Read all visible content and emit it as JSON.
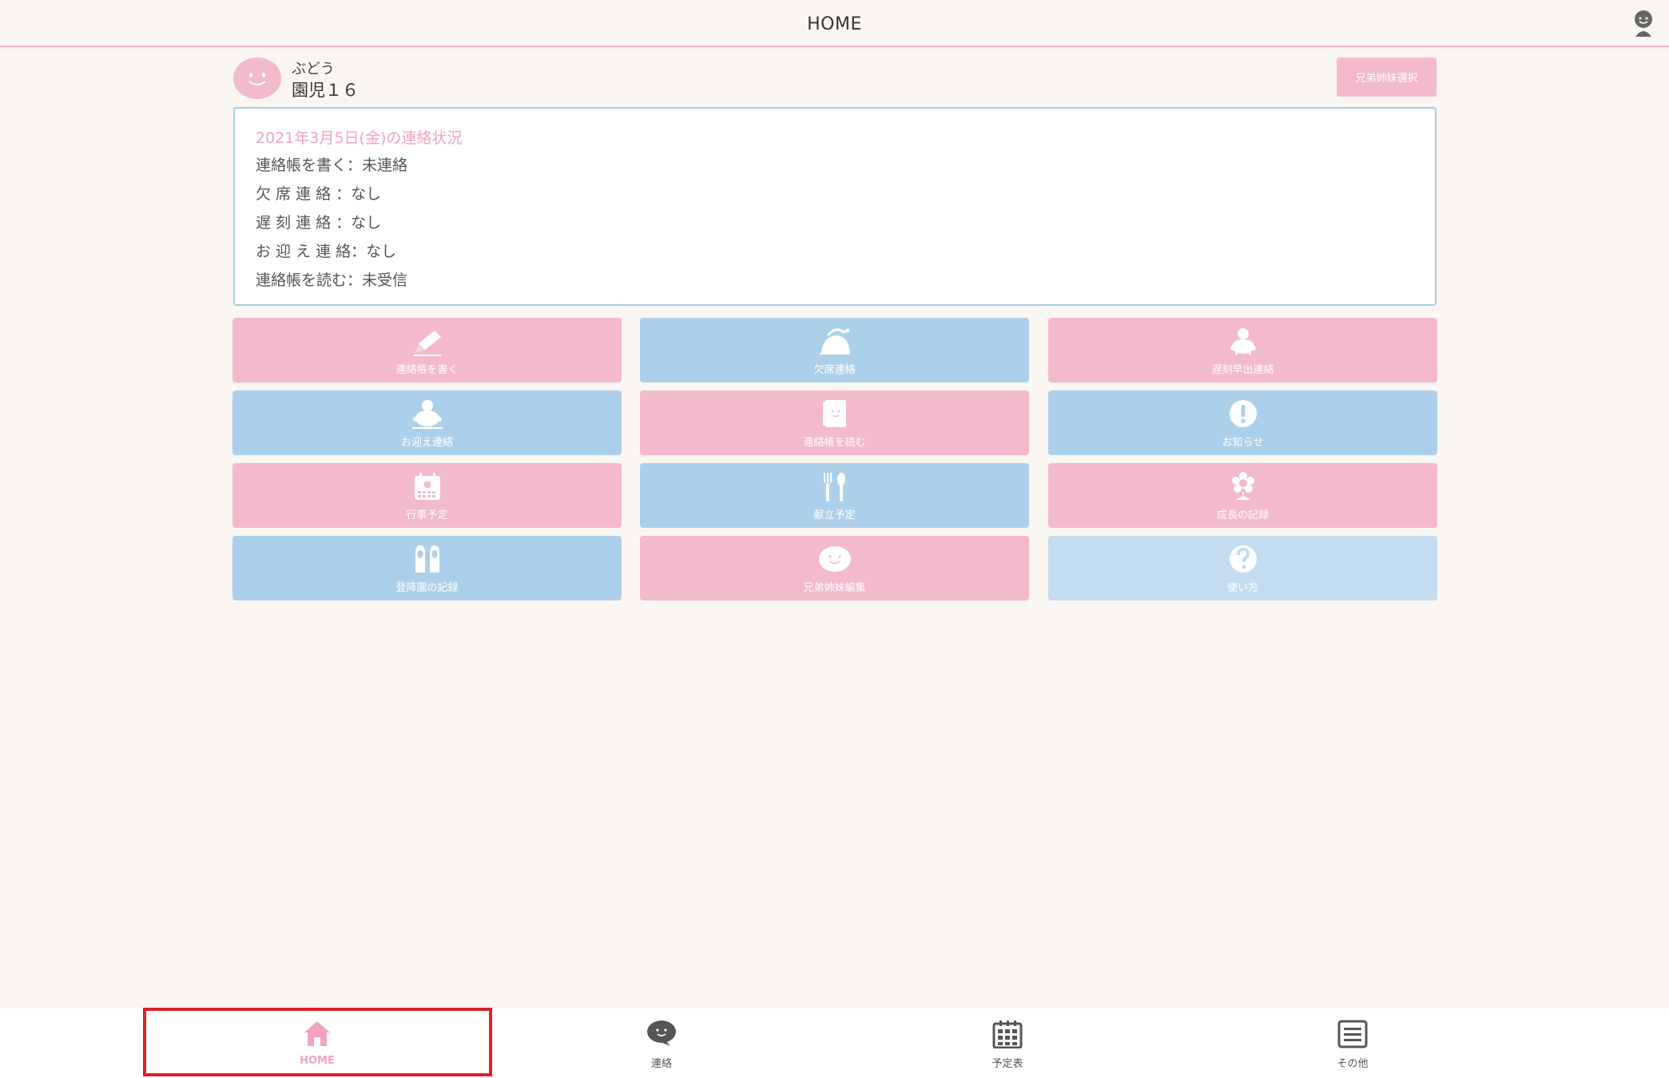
{
  "header": {
    "title": "HOME"
  },
  "profile": {
    "class_name": "ぶどう",
    "child_name": "園児１６",
    "sibling_select_label": "兄弟姉妹選択"
  },
  "status": {
    "title": "2021年3月5日(金)の連絡状況",
    "rows": [
      "連絡帳を書く：未連絡",
      "欠 席 連 絡 ：なし",
      "遅 刻 連 絡 ：なし",
      "お 迎 え 連 絡：なし",
      "連絡帳を読む：未受信"
    ]
  },
  "menu": [
    {
      "label": "連絡帳を書く",
      "icon": "pencil-icon"
    },
    {
      "label": "欠席連絡",
      "icon": "sleeping-turtle-icon"
    },
    {
      "label": "遅刻早出連絡",
      "icon": "turtle-icon"
    },
    {
      "label": "お迎え連絡",
      "icon": "turtle-pickup-icon"
    },
    {
      "label": "連絡帳を読む",
      "icon": "notebook-icon"
    },
    {
      "label": "お知らせ",
      "icon": "exclamation-icon"
    },
    {
      "label": "行事予定",
      "icon": "calendar-icon"
    },
    {
      "label": "献立予定",
      "icon": "fork-spoon-icon"
    },
    {
      "label": "成長の記録",
      "icon": "flower-icon"
    },
    {
      "label": "登降園の記録",
      "icon": "shoes-icon"
    },
    {
      "label": "兄弟姉妹編集",
      "icon": "smile-bubble-icon"
    },
    {
      "label": "使い方",
      "icon": "question-icon"
    }
  ],
  "nav": [
    {
      "label": "HOME",
      "icon": "home-icon"
    },
    {
      "label": "連絡",
      "icon": "chat-bubble-icon"
    },
    {
      "label": "予定表",
      "icon": "calendar-icon"
    },
    {
      "label": "その他",
      "icon": "menu-icon"
    }
  ],
  "colors": {
    "pink": "#f3b9cc",
    "blue": "#add0ea",
    "light_blue": "#c4dcef",
    "background": "#faf6f2",
    "highlight": "#e0202a"
  }
}
